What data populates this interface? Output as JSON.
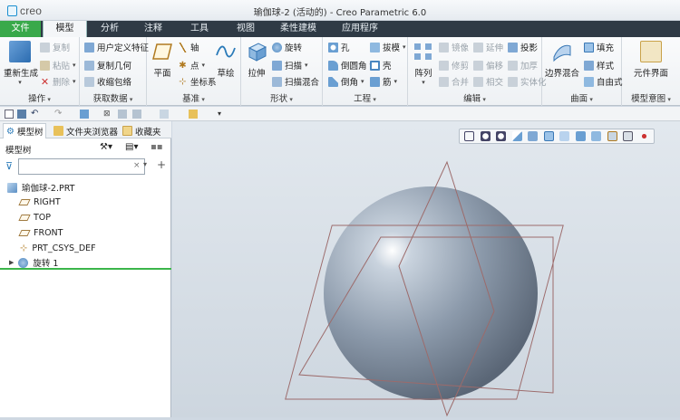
{
  "window": {
    "logo_text": "creo",
    "title": "瑜伽球-2 (活动的) - Creo Parametric 6.0"
  },
  "tabs": [
    "文件",
    "模型",
    "分析",
    "注释",
    "工具",
    "视图",
    "柔性建模",
    "应用程序"
  ],
  "active_tab": "模型",
  "ribbon": {
    "operations": {
      "label": "操作",
      "regenerate": "重新生成",
      "copy": "复制",
      "paste": "粘贴",
      "delete": "删除"
    },
    "get_data": {
      "label": "获取数据",
      "udf": "用户定义特征",
      "copy_geometry": "复制几何",
      "shrinkwrap": "收缩包络"
    },
    "datum": {
      "label": "基准",
      "plane": "平面",
      "axis": "轴",
      "point": "点",
      "csys": "坐标系",
      "sketch": "草绘"
    },
    "shapes": {
      "label": "形状",
      "extrude": "拉伸",
      "revolve": "旋转",
      "sweep": "扫描",
      "swept_blend": "扫描混合"
    },
    "engineering": {
      "label": "工程",
      "hole": "孔",
      "round": "倒圆角",
      "chamfer": "倒角",
      "draft": "拔模",
      "shell": "壳",
      "rib": "筋"
    },
    "editing": {
      "label": "编辑",
      "pattern": "阵列",
      "mirror": "镜像",
      "extend": "延伸",
      "project": "投影",
      "trim": "修剪",
      "offset": "偏移",
      "thicken": "加厚",
      "merge": "合并",
      "intersect": "相交",
      "solidify": "实体化"
    },
    "surfaces": {
      "label": "曲面",
      "boundary_blend": "边界混合",
      "fill": "填充",
      "style": "样式",
      "freestyle": "自由式"
    },
    "model_intent": {
      "label": "模型意图",
      "component_interface": "元件界面"
    }
  },
  "left_panel": {
    "tabs": [
      "模型树",
      "文件夹浏览器",
      "收藏夹"
    ],
    "tree_title": "模型树",
    "filter_placeholder": "",
    "items": [
      {
        "label": "瑜伽球-2.PRT",
        "kind": "part"
      },
      {
        "label": "RIGHT",
        "kind": "plane"
      },
      {
        "label": "TOP",
        "kind": "plane"
      },
      {
        "label": "FRONT",
        "kind": "plane"
      },
      {
        "label": "PRT_CSYS_DEF",
        "kind": "csys"
      },
      {
        "label": "旋转 1",
        "kind": "revolve"
      }
    ]
  },
  "colors": {
    "accent_green": "#39a94a",
    "tab_bar": "#2f3a45",
    "sphere": "#8c9aab",
    "datum_plane_line": "#9c6b6b"
  }
}
